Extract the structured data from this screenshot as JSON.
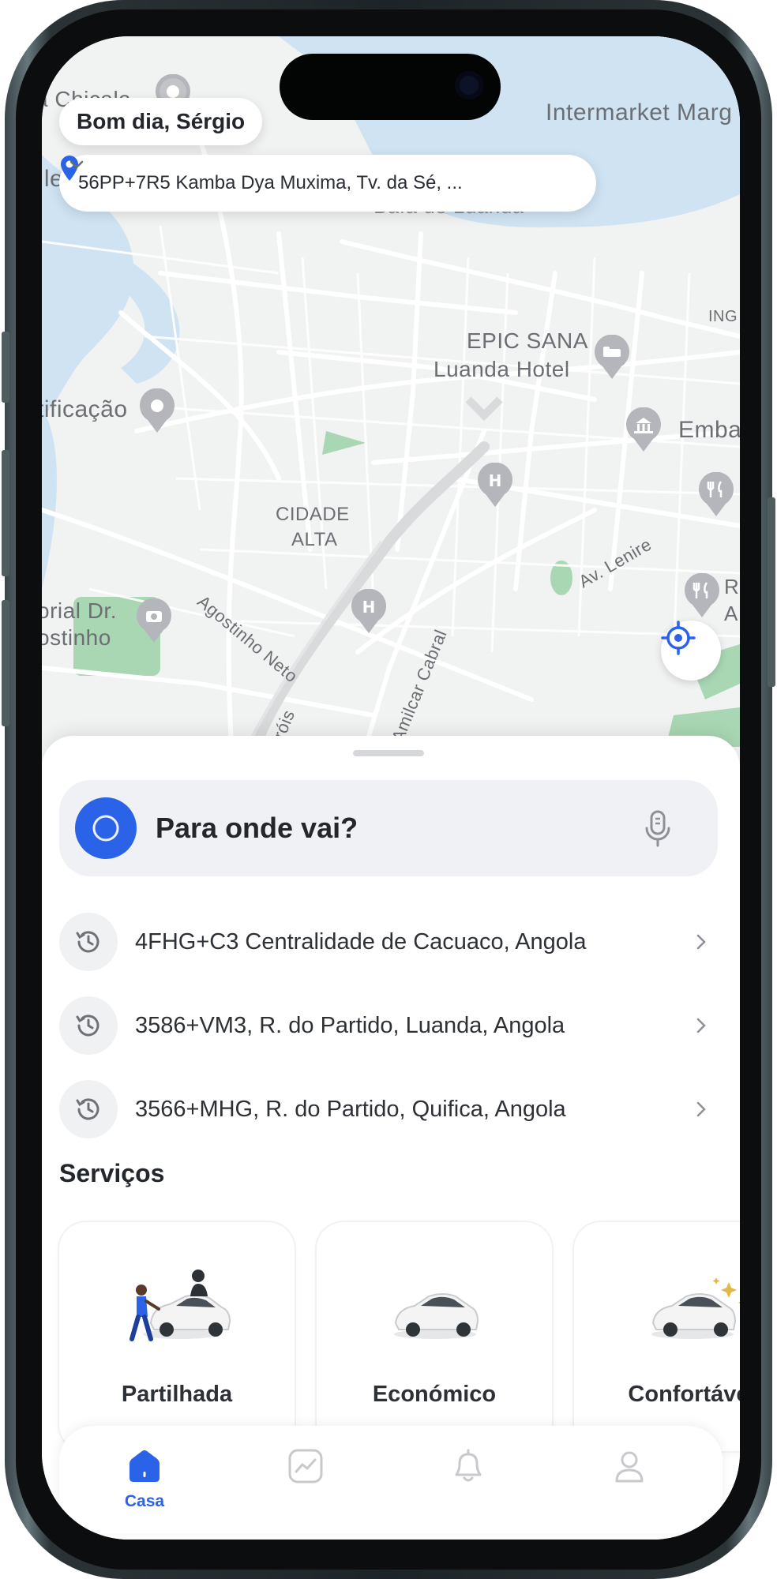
{
  "header": {
    "greeting": "Bom dia, Sérgio",
    "current_address": "56PP+7R5 Kamba Dya Muxima, Tv. da Sé, ..."
  },
  "map": {
    "labels": {
      "chicala": "a Chicala",
      "intermarket": "Intermarket Marg",
      "ilha": "Ile",
      "bay": "Baía de Luanda",
      "ing": "ING",
      "epic_sana_1": "EPIC SANA",
      "epic_sana_2": "Luanda Hotel",
      "edificacao": "tificação",
      "embassy": "Emba",
      "cidade_1": "CIDADE",
      "cidade_2": "ALTA",
      "agostinho": "Agostinho Neto",
      "av_lenine": "Av. Lenire",
      "memorial_1": "orial Dr.",
      "memorial_2": "ostinho",
      "r_label": "R",
      "a_label": "A",
      "amilcar": "Amilcar Cabral",
      "herois": "róis"
    },
    "colors": {
      "water": "#cfe3f3",
      "land": "#f1f2f2",
      "park": "#a9d7b3",
      "road": "#ffffff"
    }
  },
  "search": {
    "placeholder": "Para onde vai?",
    "icon": "search-icon",
    "voice_icon": "microphone-icon"
  },
  "recents": [
    {
      "label": "4FHG+C3 Centralidade de Cacuaco, Angola"
    },
    {
      "label": "3586+VM3, R. do Partido, Luanda, Angola"
    },
    {
      "label": "3566+MHG, R. do Partido, Quifica, Angola"
    }
  ],
  "services": {
    "title": "Serviços",
    "items": [
      {
        "name": "Partilhada"
      },
      {
        "name": "Económico"
      },
      {
        "name": "Confortável"
      }
    ]
  },
  "tabbar": {
    "tabs": [
      {
        "label": "Casa",
        "icon": "home-icon",
        "active": true
      },
      {
        "label": "",
        "icon": "activity-icon",
        "active": false
      },
      {
        "label": "",
        "icon": "bell-icon",
        "active": false
      },
      {
        "label": "",
        "icon": "profile-icon",
        "active": false
      }
    ]
  },
  "colors": {
    "accent": "#2b63e8",
    "text": "#23262b"
  }
}
